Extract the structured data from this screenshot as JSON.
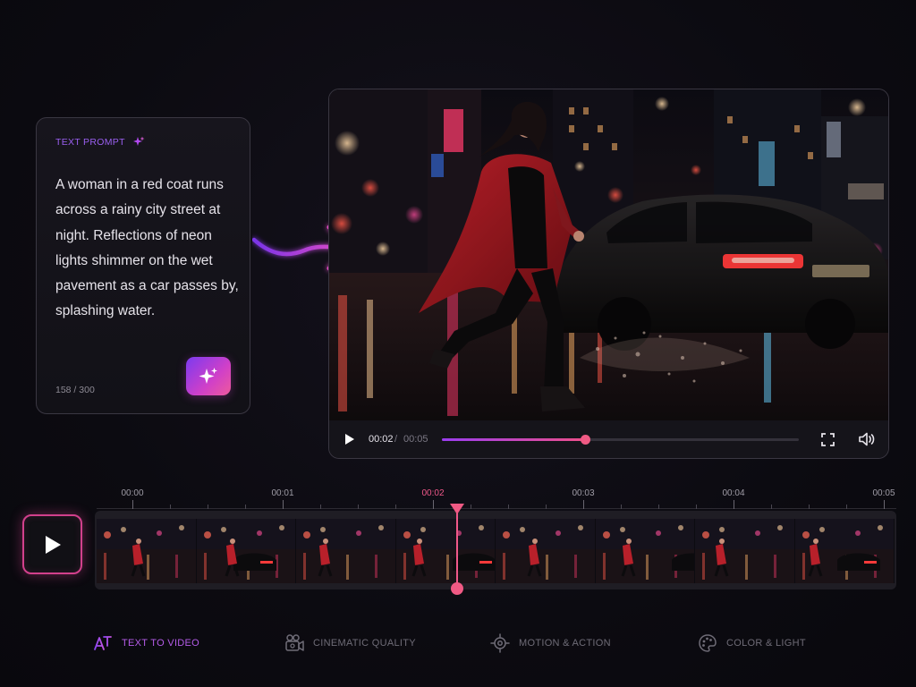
{
  "prompt_card": {
    "label": "TEXT PROMPT",
    "text": "A woman in a red coat runs across a rainy city street at night. Reflections of neon lights shimmer on the wet pavement as a car passes by, splashing water.",
    "char_count": "158 / 300",
    "icons": {
      "label_icon": "sparkle-icon",
      "generate_icon": "sparkle-icon"
    }
  },
  "player": {
    "current_time": "00:02",
    "separator": "/",
    "total_time": "00:05",
    "progress": 0.4,
    "icons": {
      "play": "play-icon",
      "fullscreen": "fullscreen-icon",
      "volume": "volume-icon"
    }
  },
  "timeline": {
    "ticks": [
      "00:00",
      "00:01",
      "00:02",
      "00:03",
      "00:04",
      "00:05"
    ],
    "active_tick": 2,
    "playhead_time_seconds": 2,
    "duration_seconds": 5,
    "thumbnail_count": 8,
    "play_icon": "play-icon"
  },
  "features": [
    {
      "label": "TEXT TO VIDEO",
      "icon": "text-to-video-icon",
      "active": true
    },
    {
      "label": "CINEMATIC QUALITY",
      "icon": "camera-icon",
      "active": false
    },
    {
      "label": "MOTION & ACTION",
      "icon": "motion-icon",
      "active": false
    },
    {
      "label": "COLOR & LIGHT",
      "icon": "palette-icon",
      "active": false
    }
  ],
  "colors": {
    "accent_purple": "#9a3df0",
    "accent_pink": "#f0588a",
    "background": "#0c0b11"
  }
}
